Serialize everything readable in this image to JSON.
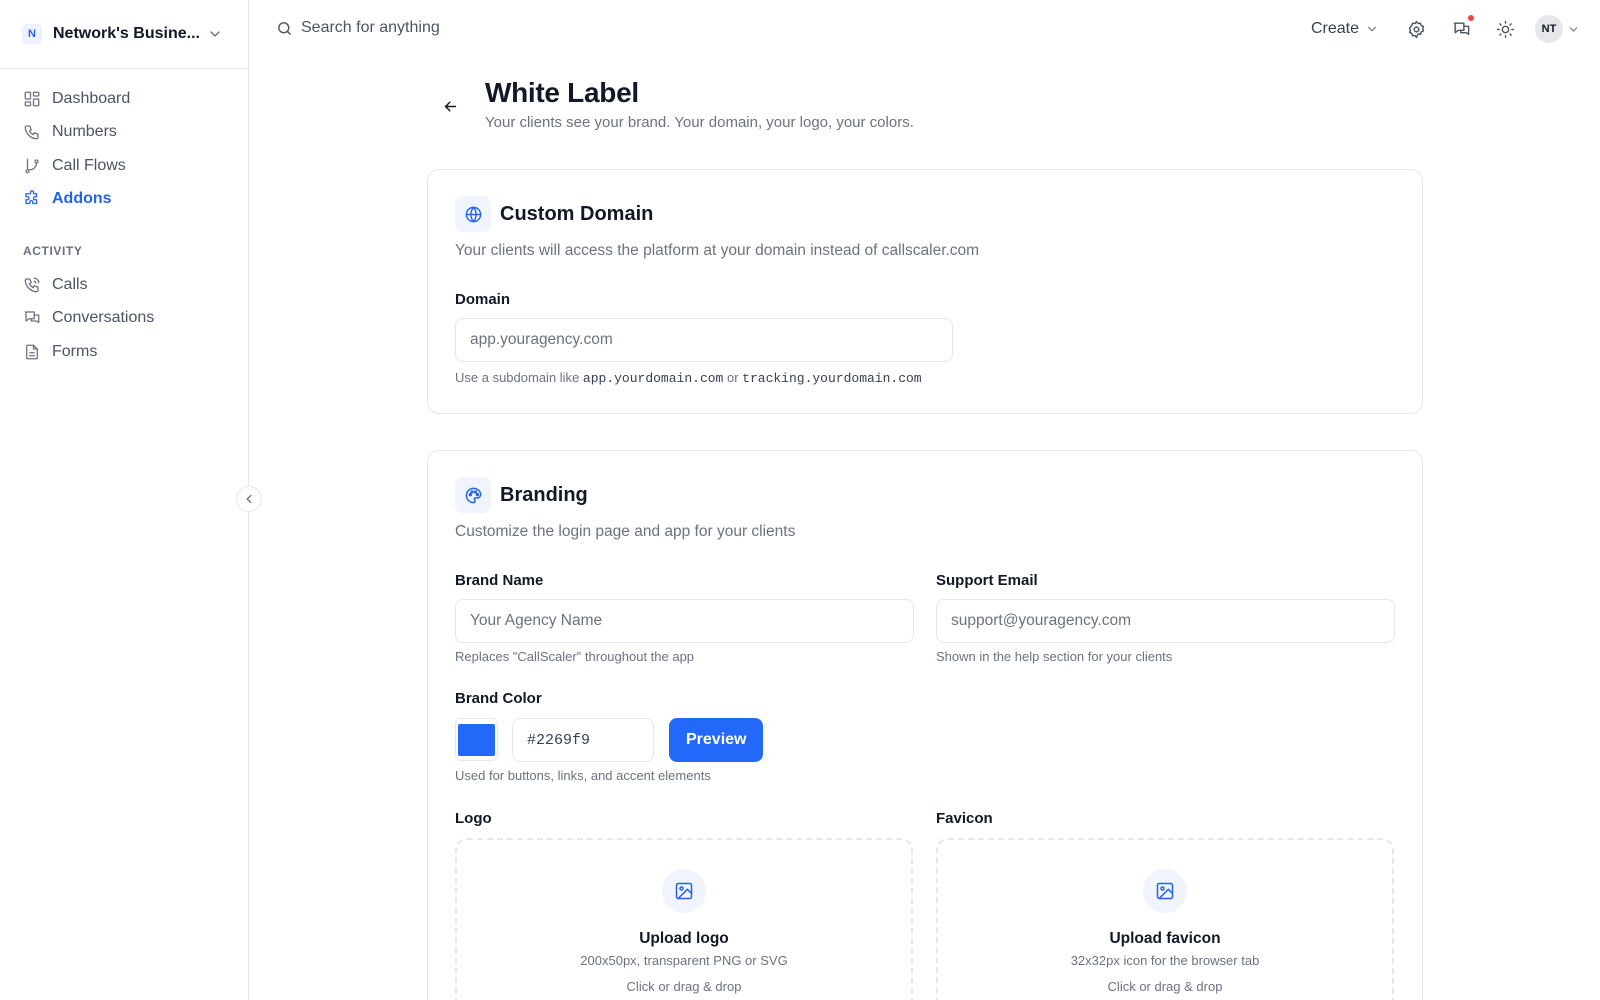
{
  "workspace": {
    "avatar": "N",
    "name": "Network's Busine..."
  },
  "sidebar": {
    "items": [
      {
        "label": "Dashboard",
        "icon": "dashboard-icon"
      },
      {
        "label": "Numbers",
        "icon": "phone-icon"
      },
      {
        "label": "Call Flows",
        "icon": "flow-icon"
      },
      {
        "label": "Addons",
        "icon": "puzzle-icon",
        "active": true
      }
    ],
    "section_label": "ACTIVITY",
    "activity_items": [
      {
        "label": "Calls",
        "icon": "phone-call-icon"
      },
      {
        "label": "Conversations",
        "icon": "chat-icon"
      },
      {
        "label": "Forms",
        "icon": "form-icon"
      }
    ]
  },
  "topbar": {
    "search_placeholder": "Search for anything",
    "create_label": "Create",
    "user_initials": "NT"
  },
  "header": {
    "title": "White Label",
    "subtitle": "Your clients see your brand. Your domain, your logo, your colors."
  },
  "custom_domain": {
    "title": "Custom Domain",
    "description": "Your clients will access the platform at your domain instead of callscaler.com",
    "domain_label": "Domain",
    "domain_placeholder": "app.youragency.com",
    "hint_prefix": "Use a subdomain like",
    "hint_example1": "app.yourdomain.com",
    "hint_or": "or",
    "hint_example2": "tracking.yourdomain.com"
  },
  "branding": {
    "title": "Branding",
    "description": "Customize the login page and app for your clients",
    "brand_name_label": "Brand Name",
    "brand_name_placeholder": "Your Agency Name",
    "brand_name_hint": "Replaces \"CallScaler\" throughout the app",
    "support_email_label": "Support Email",
    "support_email_placeholder": "support@youragency.com",
    "support_email_hint": "Shown in the help section for your clients",
    "brand_color_label": "Brand Color",
    "brand_color_value": "#2269f9",
    "preview_label": "Preview",
    "brand_color_hint": "Used for buttons, links, and accent elements",
    "logo_label": "Logo",
    "logo_upload_title": "Upload logo",
    "logo_upload_sub": "200x50px, transparent PNG or SVG",
    "logo_upload_cta": "Click or drag & drop",
    "favicon_label": "Favicon",
    "favicon_upload_title": "Upload favicon",
    "favicon_upload_sub": "32x32px icon for the browser tab",
    "favicon_upload_cta": "Click or drag & drop"
  },
  "colors": {
    "accent": "#2563eb",
    "brand": "#2269f9",
    "notification": "#ef4444"
  }
}
